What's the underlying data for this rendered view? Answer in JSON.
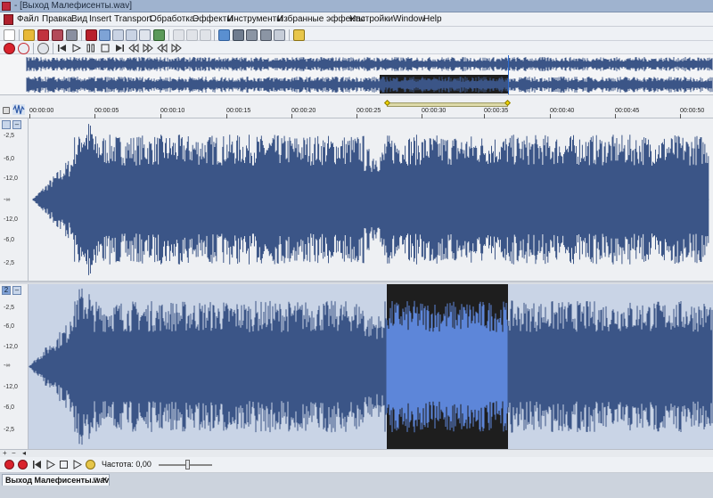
{
  "window": {
    "title": "- [Выход Малефисенты.wav]"
  },
  "menu": [
    "Файл",
    "Правка",
    "Вид",
    "Insert",
    "Transport",
    "Обработка",
    "Эффекты",
    "Инструменты",
    "Избранные эффекты",
    "Настройки",
    "Window",
    "Help"
  ],
  "icons": {
    "toolbar1": [
      "new-file-icon",
      "open-folder-icon",
      "save-icon",
      "save-as-icon",
      "render-icon",
      "scissors-icon",
      "copy-icon",
      "paste-icon",
      "mix-paste-icon",
      "crop-icon",
      "undo-icon",
      "redo-icon",
      "history-icon",
      "waveform-view-icon",
      "spectrum-view-icon",
      "markers-icon",
      "regions-icon",
      "zoom-icon",
      "properties-icon"
    ],
    "toolbar2": [
      "record-icon",
      "record-options-icon",
      "loop-icon",
      "go-start-icon",
      "play-icon",
      "pause-icon",
      "stop-icon",
      "go-end-icon",
      "rewind-icon",
      "forward-icon",
      "prev-marker-icon",
      "next-marker-icon"
    ],
    "transport": [
      "record-icon",
      "record-arm-icon",
      "go-start-icon",
      "play-icon",
      "stop-icon",
      "play-loop-icon",
      "scrub-icon"
    ]
  },
  "timeline": {
    "ticks": [
      "00:00:00",
      "00:00:05",
      "00:00:10",
      "00:00:15",
      "00:00:20",
      "00:00:25",
      "00:00:30",
      "00:00:35",
      "00:00:40",
      "00:00:45",
      "00:00:50"
    ]
  },
  "channel1": {
    "number": "",
    "db_labels": [
      "-2,5",
      "-6,0",
      "-12,0",
      "-∞",
      "-12,0",
      "-6,0",
      "-2,5"
    ]
  },
  "channel2": {
    "number": "2",
    "db_labels": [
      "-2,5",
      "-6,0",
      "-12,0",
      "-∞",
      "-12,0",
      "-6,0",
      "-2,5"
    ]
  },
  "transport": {
    "rate_label": "Частота: 0,00"
  },
  "doc_tab": {
    "label": "Выход Малефисенты.wav"
  },
  "colors": {
    "wave": "#3b5587",
    "wave_selected": "#5d86d9",
    "selection_bg": "#1e1e1e",
    "channel_bg": "#eef0f3",
    "channel_dim_bg": "#c9d4e6"
  }
}
